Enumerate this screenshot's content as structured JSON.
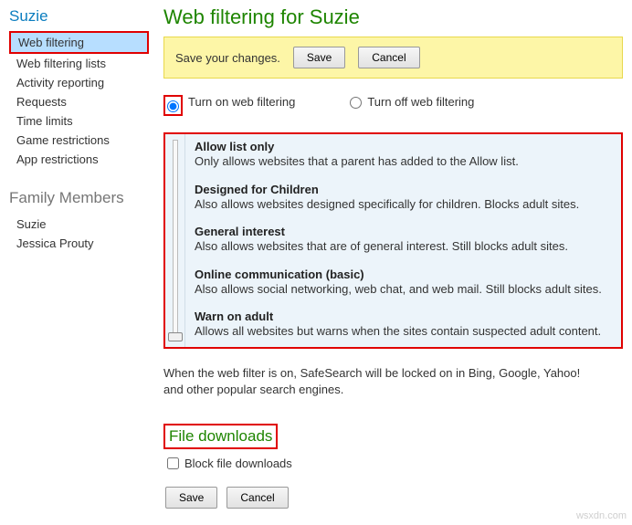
{
  "sidebar": {
    "title": "Suzie",
    "items": [
      {
        "label": "Web filtering"
      },
      {
        "label": "Web filtering lists"
      },
      {
        "label": "Activity reporting"
      },
      {
        "label": "Requests"
      },
      {
        "label": "Time limits"
      },
      {
        "label": "Game restrictions"
      },
      {
        "label": "App restrictions"
      }
    ],
    "family_heading": "Family Members",
    "family": [
      {
        "label": "Suzie"
      },
      {
        "label": "Jessica Prouty"
      }
    ]
  },
  "page": {
    "title": "Web filtering for Suzie",
    "banner_text": "Save your changes.",
    "save_btn": "Save",
    "cancel_btn": "Cancel"
  },
  "radios": {
    "on_label": "Turn on web filtering",
    "off_label": "Turn off web filtering"
  },
  "levels": [
    {
      "title": "Allow list only",
      "desc": "Only allows websites that a parent has added to the Allow list."
    },
    {
      "title": "Designed for Children",
      "desc": "Also allows websites designed specifically for children. Blocks adult sites."
    },
    {
      "title": "General interest",
      "desc": "Also allows websites that are of general interest. Still blocks adult sites."
    },
    {
      "title": "Online communication (basic)",
      "desc": "Also allows social networking, web chat, and web mail. Still blocks adult sites."
    },
    {
      "title": "Warn on adult",
      "desc": "Allows all websites but warns when the sites contain suspected adult content."
    }
  ],
  "note": "When the web filter is on, SafeSearch will be locked on in Bing, Google, Yahoo! and other popular search engines.",
  "downloads": {
    "heading": "File downloads",
    "checkbox_label": "Block file downloads"
  },
  "bottom": {
    "save": "Save",
    "cancel": "Cancel"
  },
  "watermark": "wsxdn.com"
}
